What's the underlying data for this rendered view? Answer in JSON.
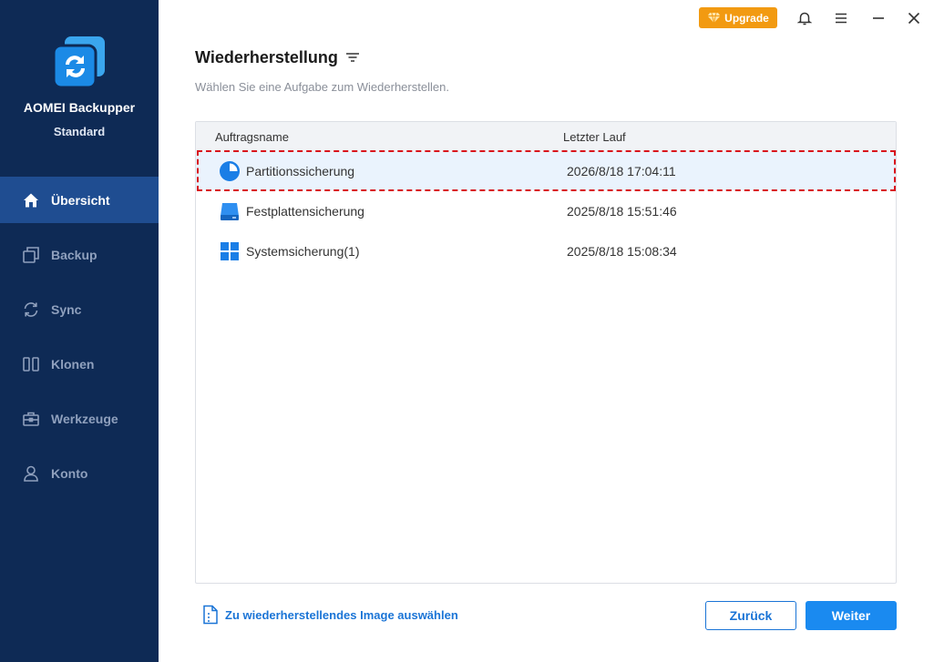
{
  "app": {
    "name": "AOMEI Backupper",
    "edition": "Standard"
  },
  "sidebar": {
    "items": [
      {
        "label": "Übersicht",
        "icon": "home-icon",
        "active": true
      },
      {
        "label": "Backup",
        "icon": "backup-icon",
        "active": false
      },
      {
        "label": "Sync",
        "icon": "sync-icon",
        "active": false
      },
      {
        "label": "Klonen",
        "icon": "clone-icon",
        "active": false
      },
      {
        "label": "Werkzeuge",
        "icon": "tools-icon",
        "active": false
      },
      {
        "label": "Konto",
        "icon": "user-icon",
        "active": false
      }
    ]
  },
  "topbar": {
    "upgrade_label": "Upgrade",
    "icons": [
      "bell-icon",
      "menu-icon",
      "minimize-icon",
      "close-icon"
    ]
  },
  "main": {
    "title": "Wiederherstellung",
    "subtitle": "Wählen Sie eine Aufgabe zum Wiederherstellen.",
    "table": {
      "columns": [
        "Auftragsname",
        "Letzter Lauf"
      ],
      "rows": [
        {
          "name": "Partitionssicherung",
          "last_run": "2026/8/18 17:04:11",
          "icon": "partition-backup-icon",
          "selected": true
        },
        {
          "name": "Festplattensicherung",
          "last_run": "2025/8/18 15:51:46",
          "icon": "disk-backup-icon",
          "selected": false
        },
        {
          "name": "Systemsicherung(1)",
          "last_run": "2025/8/18 15:08:34",
          "icon": "system-backup-icon",
          "selected": false
        }
      ]
    },
    "select_image_link": "Zu wiederherstellendes Image auswählen",
    "back_label": "Zurück",
    "next_label": "Weiter"
  },
  "colors": {
    "sidebar_bg": "#0e2a55",
    "sidebar_active": "#1f4d91",
    "accent": "#1a8af0",
    "upgrade": "#f29a11",
    "highlight_border": "#d9141c"
  }
}
